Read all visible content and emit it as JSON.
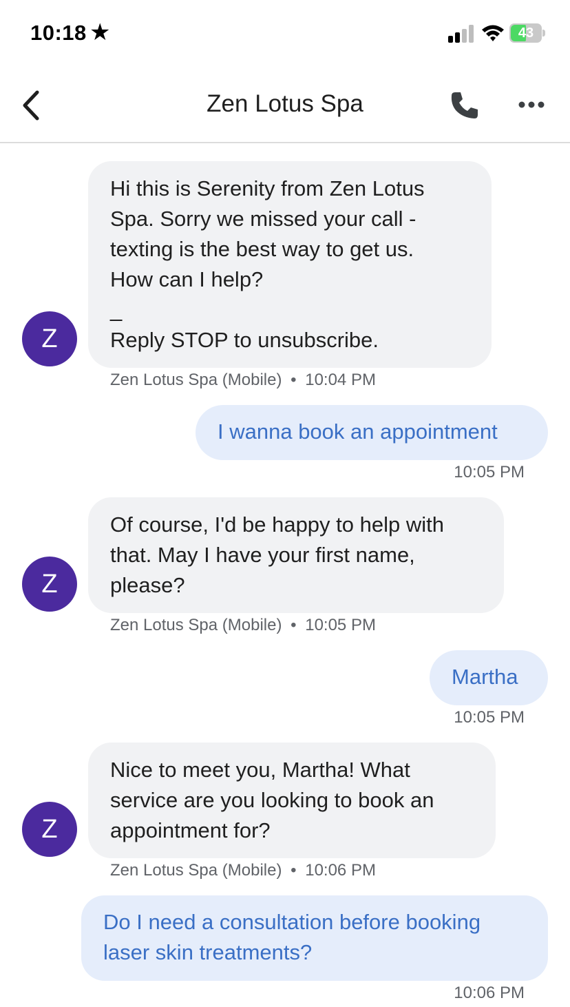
{
  "status_bar": {
    "time": "10:18",
    "star": "★",
    "battery_level": "43",
    "battery_color": "#4cd964",
    "icons": [
      "signal-icon",
      "wifi-icon",
      "battery-icon"
    ]
  },
  "app_bar": {
    "title": "Zen Lotus Spa",
    "icons": [
      "back-arrow-icon",
      "phone-icon",
      "more-icon"
    ]
  },
  "avatar_letter": "Z",
  "colors": {
    "avatar": "#4b2a9e",
    "incoming_bubble": "#f1f2f4",
    "outgoing_bubble": "#e5edfb",
    "outgoing_text": "#3a6fc5"
  },
  "messages": [
    {
      "direction": "incoming",
      "text": "Hi  this is Serenity from Zen Lotus\nSpa. Sorry we missed your call -\ntexting is the best way to get us.\nHow can I help?\n_\nReply STOP to unsubscribe.",
      "sender": "Zen Lotus Spa (Mobile)",
      "time": "10:04 PM"
    },
    {
      "direction": "outgoing",
      "text": "I wanna book an appointment",
      "time": "10:05 PM"
    },
    {
      "direction": "incoming",
      "text": "Of course, I'd be happy to help with\nthat. May I have your first name,\nplease?",
      "sender": "Zen Lotus Spa (Mobile)",
      "time": "10:05 PM"
    },
    {
      "direction": "outgoing",
      "text": "Martha",
      "time": "10:05 PM"
    },
    {
      "direction": "incoming",
      "text": "Nice to meet you, Martha! What\nservice are you looking to book an\nappointment for?",
      "sender": "Zen Lotus Spa (Mobile)",
      "time": "10:06 PM"
    },
    {
      "direction": "outgoing",
      "text": "Do I need a consultation before booking\nlaser skin treatments?",
      "time": "10:06 PM"
    }
  ],
  "meta_separator": "•"
}
